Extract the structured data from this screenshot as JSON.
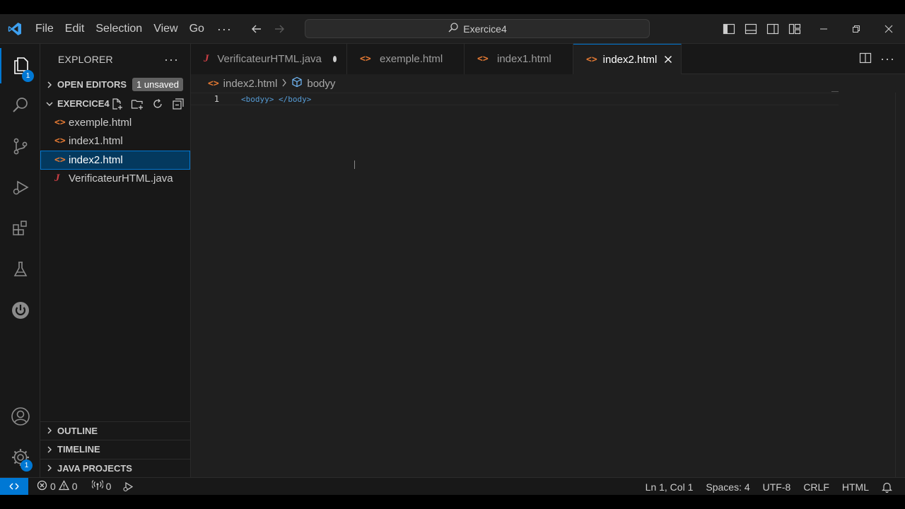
{
  "titlebar": {
    "menu": [
      "File",
      "Edit",
      "Selection",
      "View",
      "Go"
    ],
    "more": "···",
    "search_text": "Exercice4"
  },
  "activity": {
    "explorer_badge": "1",
    "settings_badge": "1"
  },
  "sidebar": {
    "title": "EXPLORER",
    "more": "···",
    "open_editors_label": "OPEN EDITORS",
    "unsaved_badge": "1 unsaved",
    "folder_label": "EXERCICE4",
    "files": [
      {
        "name": "exemple.html",
        "icon": "<>"
      },
      {
        "name": "index1.html",
        "icon": "<>"
      },
      {
        "name": "index2.html",
        "icon": "<>"
      },
      {
        "name": "VerificateurHTML.java",
        "icon": "J"
      }
    ],
    "outline_label": "OUTLINE",
    "timeline_label": "TIMELINE",
    "java_projects_label": "JAVA PROJECTS"
  },
  "tabs": [
    {
      "label": "VerificateurHTML.java",
      "icon": "J"
    },
    {
      "label": "exemple.html",
      "icon": "<>"
    },
    {
      "label": "index1.html",
      "icon": "<>"
    },
    {
      "label": "index2.html",
      "icon": "<>"
    }
  ],
  "editor": {
    "breadcrumb_file": "index2.html",
    "breadcrumb_symbol": "bodyy",
    "line_number": "1",
    "code_open": "<bodyy>",
    "code_close": "</body>"
  },
  "statusbar": {
    "errors": "0",
    "warnings": "0",
    "ports": "0",
    "position": "Ln 1, Col 1",
    "spaces": "Spaces: 4",
    "encoding": "UTF-8",
    "eol": "CRLF",
    "language": "HTML"
  },
  "colors": {
    "accent": "#0078d4",
    "html_icon": "#e37933",
    "java_icon": "#cc3e44"
  }
}
